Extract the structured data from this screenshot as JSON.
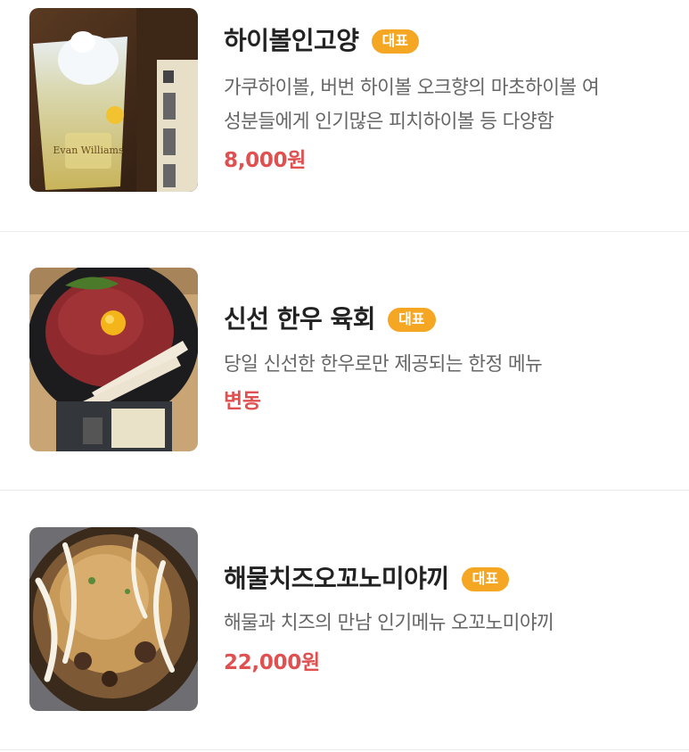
{
  "menu": {
    "items": [
      {
        "name": "하이볼인고양",
        "badge": "대표",
        "description_lines": [
          "가쿠하이볼, 버번 하이볼 오크향의 마초하이볼 여",
          "성분들에게 인기많은 피치하이볼 등 다양함"
        ],
        "price": "8,000원",
        "image_label": "Evan Williams"
      },
      {
        "name": "신선 한우 육회",
        "badge": "대표",
        "description_lines": [
          "당일 신선한 한우로만 제공되는 한정 메뉴"
        ],
        "price": "변동"
      },
      {
        "name": "해물치즈오꼬노미야끼",
        "badge": "대표",
        "description_lines": [
          "해물과 치즈의 만남 인기메뉴 오꼬노미야끼"
        ],
        "price": "22,000원"
      }
    ]
  },
  "colors": {
    "badge": "#f5a623",
    "price": "#e15050",
    "name": "#222222",
    "description": "#666666",
    "divider": "#ebebeb"
  }
}
